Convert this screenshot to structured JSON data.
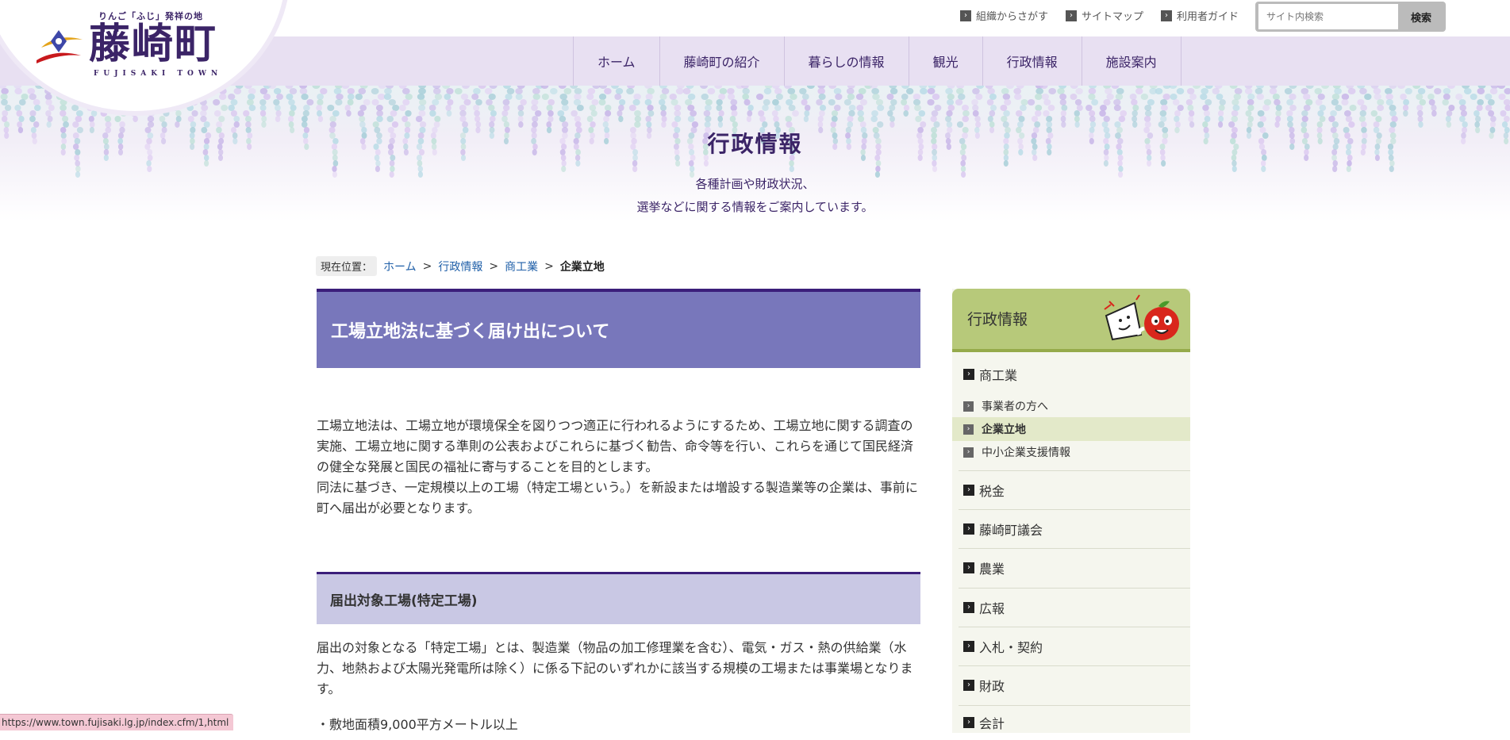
{
  "header": {
    "logo": {
      "tagline": "りんご「ふじ」発祥の地",
      "title": "藤崎町",
      "romaji": "FUJISAKI TOWN"
    },
    "util_links": [
      "組織からさがす",
      "サイトマップ",
      "利用者ガイド"
    ],
    "search": {
      "placeholder": "サイト内検索",
      "button": "検索"
    },
    "nav": [
      "ホーム",
      "藤崎町の紹介",
      "暮らしの情報",
      "観光",
      "行政情報",
      "施設案内"
    ]
  },
  "hero": {
    "title": "行政情報",
    "desc_line1": "各種計画や財政状況、",
    "desc_line2": "選挙などに関する情報をご案内しています。"
  },
  "breadcrumb": {
    "label": "現在位置：",
    "items": [
      "ホーム",
      "行政情報",
      "商工業"
    ],
    "current": "企業立地"
  },
  "content": {
    "page_title": "工場立地法に基づく届け出について",
    "intro": "工場立地法は、工場立地が環境保全を図りつつ適正に行われるようにするため、工場立地に関する調査の実施、工場立地に関する準則の公表およびこれらに基づく勧告、命令等を行い、これらを通じて国民経済の健全な発展と国民の福祉に寄与することを目的とします。",
    "intro2": "同法に基づき、一定規模以上の工場（特定工場という。）を新設または増設する製造業等の企業は、事前に町へ届出が必要となります。",
    "section_title": "届出対象工場(特定工場)",
    "section_body": "届出の対象となる「特定工場」とは、製造業（物品の加工修理業を含む）、電気・ガス・熱の供給業（水力、地熱および太陽光発電所は除く）に係る下記のいずれかに該当する規模の工場または事業場となります。",
    "bullet": "・敷地面積9,000平方メートル以上"
  },
  "sidebar": {
    "title": "行政情報",
    "category": "商工業",
    "sub_items": [
      "事業者の方へ",
      "企業立地",
      "中小企業支援情報"
    ],
    "items": [
      "税金",
      "藤崎町議会",
      "農業",
      "広報",
      "入札・契約",
      "財政",
      "会計"
    ]
  },
  "status_url": "https://www.town.fujisaki.lg.jp/index.cfm/1,html",
  "colors": {
    "brand_purple": "#3b2467",
    "nav_band": "#e8e0f2",
    "title_box": "#7877bb",
    "section_head": "#c9c8e4",
    "sidebar_head": "#b7c97a",
    "sidebar_active": "#e3e9c9",
    "link": "#1f5fa8"
  }
}
